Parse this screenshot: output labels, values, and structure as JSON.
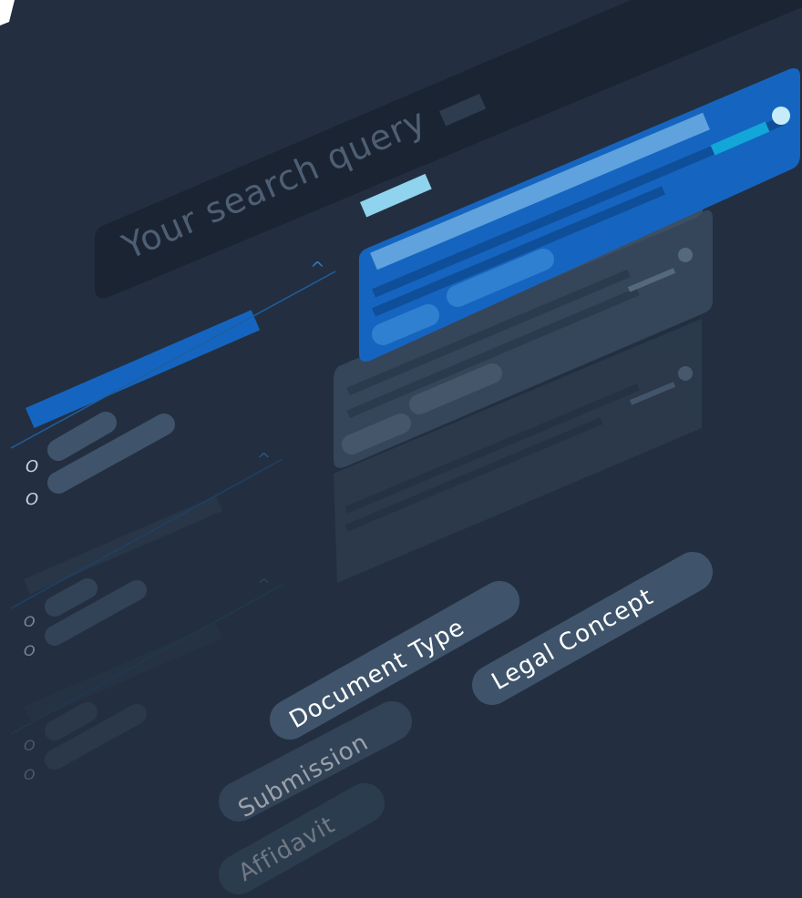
{
  "search": {
    "placeholder": "Your search query"
  },
  "filter_panel": {
    "option_marker": "O",
    "expand_glyph": "^"
  },
  "tags": {
    "document_type": "Document Type",
    "legal_concept": "Legal Concept",
    "submission": "Submission",
    "affidavit": "Affidavit"
  },
  "colors": {
    "background": "#232f40",
    "search_bar": "#1b2433",
    "accent_blue": "#1565c0",
    "highlight_cyan": "#8fd3ee",
    "card_gray": "#374a5e",
    "pill": "#3f546b"
  }
}
